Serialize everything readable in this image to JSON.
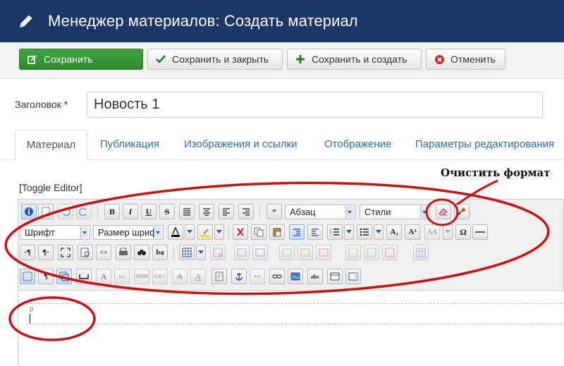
{
  "header": {
    "title": "Менеджер материалов: Создать материал",
    "icon": "pencil-icon"
  },
  "toolbar": {
    "save_label": "Сохранить",
    "save_close_label": "Сохранить и закрыть",
    "save_new_label": "Сохранить и создать",
    "cancel_label": "Отменить"
  },
  "form": {
    "title_label": "Заголовок *",
    "title_value": "Новость 1"
  },
  "tabs": [
    {
      "label": "Материал",
      "active": true
    },
    {
      "label": "Публикация"
    },
    {
      "label": "Изображения и ссылки"
    },
    {
      "label": "Отображение"
    },
    {
      "label": "Параметры редактирования"
    }
  ],
  "editor": {
    "toggle_label": "[Toggle Editor]",
    "format_select": "Абзац",
    "styles_select": "Стили",
    "font_select": "Шрифт",
    "size_select": "Размер шриф",
    "paragraph_label": "p"
  },
  "annotation": {
    "text": "Очистить формат"
  },
  "colors": {
    "header_bg": "#1a3867",
    "save_green": "#2d8a2d",
    "link_blue": "#2a6fb5",
    "annotation_red": "#cc1111"
  }
}
